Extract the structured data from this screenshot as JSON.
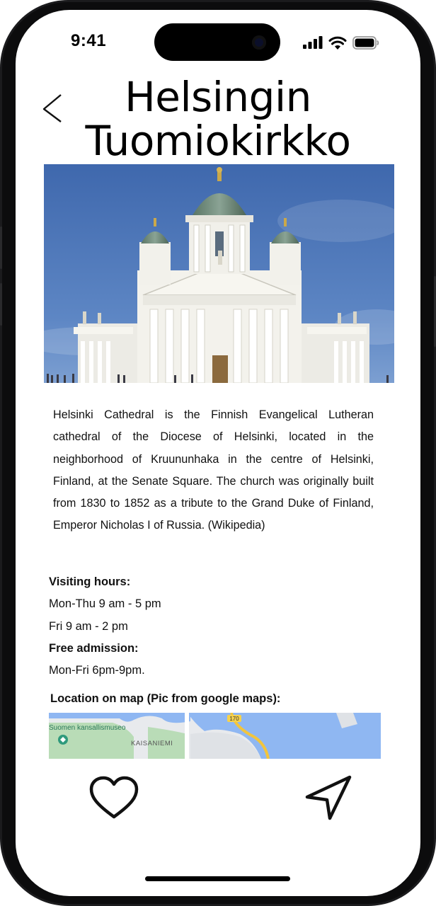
{
  "status_bar": {
    "time": "9:41"
  },
  "header": {
    "title": "Helsingin Tuomiokirkko"
  },
  "description": "Helsinki Cathedral is the Finnish Evangelical Lutheran cathedral of the Diocese of Helsinki, located in the neighborhood of Kruununhaka in the centre of Helsinki, Finland, at the Senate Square. The church was originally built from 1830 to 1852 as a tribute to the Grand Duke of Finland, Emperor Nicholas I of Russia. (Wikipedia)",
  "visiting": {
    "heading": "Visiting hours:",
    "hours_weekday": "Mon-Thu 9 am - 5 pm",
    "hours_friday": "Fri 9 am - 2 pm",
    "admission_heading": "Free admission:",
    "admission_hours": "Mon-Fri 6pm-9pm."
  },
  "location": {
    "label": "Location on map (Pic from google maps):",
    "map_labels": {
      "museum": "Suomen kansallismuseo",
      "district": "KAISANIEMI",
      "road": "170"
    }
  },
  "icons": {
    "back": "chevron-left-icon",
    "favorite": "heart-icon",
    "navigate": "navigation-arrow-icon"
  },
  "colors": {
    "sky": "#4b72b4",
    "cathedral": "#f1f0ea",
    "dome": "#6f8a7a",
    "map_water": "#8fb7f2",
    "map_park": "#b9dcb7"
  }
}
